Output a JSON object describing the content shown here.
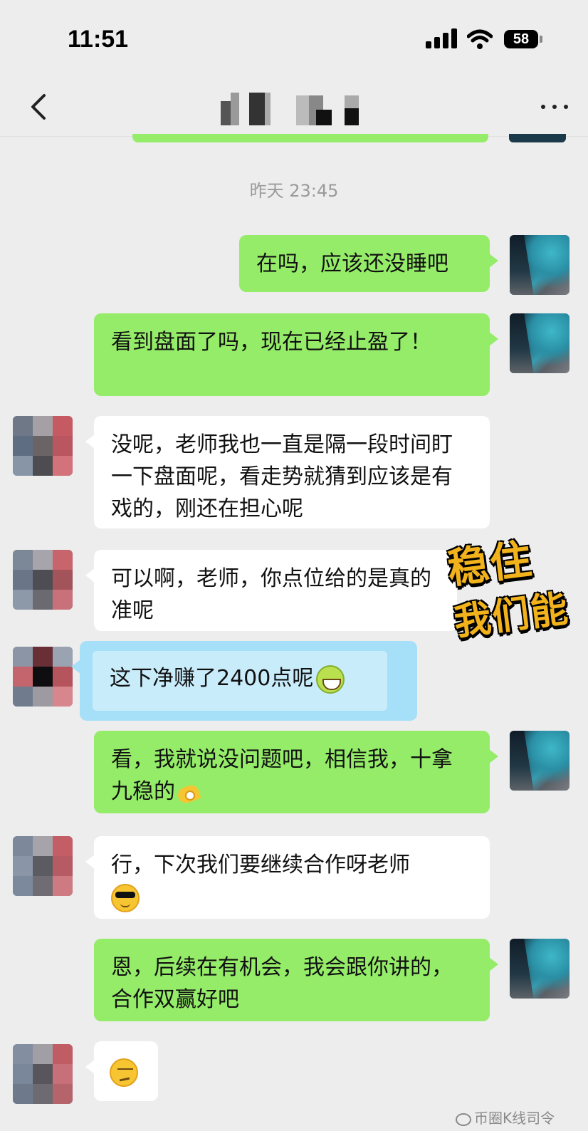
{
  "status_bar": {
    "time": "11:51",
    "battery": "58",
    "icons": [
      "signal-icon",
      "wifi-icon",
      "battery-icon"
    ]
  },
  "nav": {
    "back_icon": "chevron-left-icon",
    "more_icon": "more-dots-icon"
  },
  "timestamp": "昨天 23:45",
  "messages": [
    {
      "side": "right",
      "text": "在吗，应该还没睡吧"
    },
    {
      "side": "right",
      "text": "看到盘面了吗，现在已经止盈了！"
    },
    {
      "side": "left",
      "text": "没呢，老师我也一直是隔一段时间盯一下盘面呢，看走势就猜到应该是有戏的，刚还在担心呢"
    },
    {
      "side": "left",
      "text": "可以啊，老师，你点位给的是真的准呢"
    },
    {
      "side": "left",
      "text": "这下净赚了2400点呢",
      "emoji": "grin-emoji",
      "highlight": true
    },
    {
      "side": "right",
      "text": "看，我就说没问题吧，相信我，十拿九稳的",
      "emoji": "ok-hand-emoji"
    },
    {
      "side": "left",
      "text": "行，下次我们要继续合作呀老师",
      "emoji": "sunglasses-emoji"
    },
    {
      "side": "right",
      "text": "恩，后续在有机会，我会跟你讲的，合作双赢好吧"
    },
    {
      "side": "left",
      "emoji": "smirk-emoji"
    }
  ],
  "sticker": {
    "line1": "稳住",
    "line2": "我们能"
  },
  "watermark": "币圈K线司令",
  "colors": {
    "background": "#ededed",
    "self_bubble": "#95ec69",
    "other_bubble": "#ffffff",
    "highlight_bubble": "#a6dff8",
    "timestamp": "#9a9a9a",
    "sticker_text": "#f1b21b"
  }
}
